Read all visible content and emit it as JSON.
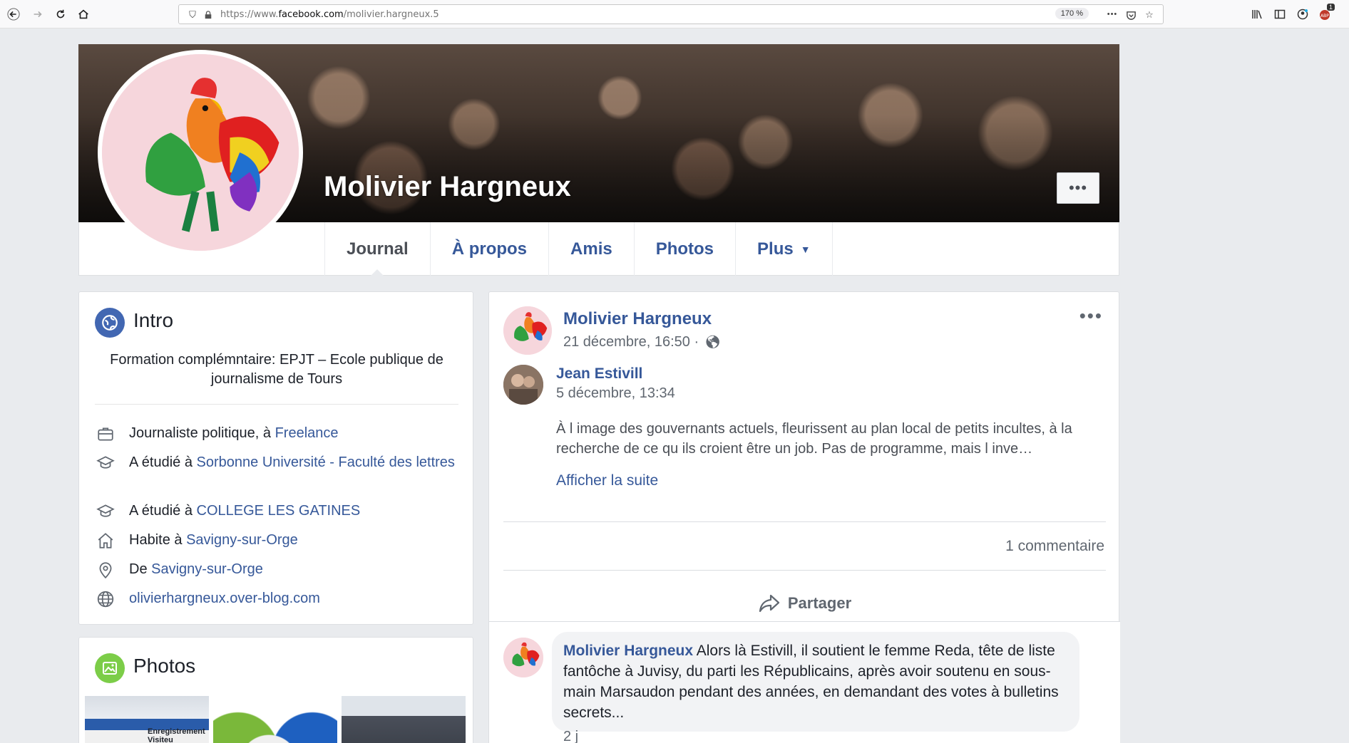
{
  "browser": {
    "url_prefix": "https://www.",
    "url_domain": "facebook.com",
    "url_path": "/molivier.hargneux.5",
    "zoom": "170 %",
    "more_label": "•••",
    "notif_badge": "1"
  },
  "profile": {
    "name": "Molivier Hargneux",
    "cover_more_label": "•••"
  },
  "tabs": [
    {
      "label": "Journal"
    },
    {
      "label": "À propos"
    },
    {
      "label": "Amis"
    },
    {
      "label": "Photos"
    },
    {
      "label": "Plus"
    }
  ],
  "intro": {
    "title": "Intro",
    "description": "Formation complémntaire: EPJT – Ecole publique de journalisme de Tours",
    "items": [
      {
        "icon": "briefcase-icon",
        "prefix": "Journaliste politique, à ",
        "link": "Freelance"
      },
      {
        "icon": "graduation-cap-icon",
        "prefix": "A étudié à ",
        "link": "Sorbonne Université - Faculté des lettres"
      },
      {
        "icon": "graduation-cap-icon",
        "prefix": "A étudié à ",
        "link": "COLLEGE LES GATINES"
      },
      {
        "icon": "home-icon",
        "prefix": "Habite à ",
        "link": "Savigny-sur-Orge"
      },
      {
        "icon": "location-pin-icon",
        "prefix": "De ",
        "link": "Savigny-sur-Orge"
      },
      {
        "icon": "globe-icon",
        "prefix": "",
        "link": "olivierhargneux.over-blog.com"
      }
    ]
  },
  "photos": {
    "title": "Photos",
    "thumb1_caption": "Enregistrement Visiteu"
  },
  "post": {
    "author": "Molivier Hargneux",
    "time": "21 décembre, 16:50 ·",
    "menu_label": "•••",
    "shared": {
      "author": "Jean Estivill",
      "time": "5 décembre, 13:34",
      "text": "À l image des gouvernants actuels, fleurissent au plan local de petits incultes, à la recherche de ce qu ils croient être un job. Pas de programme, mais l inve…",
      "see_more": "Afficher la suite"
    },
    "comment_count": "1 commentaire",
    "share_label": "Partager",
    "comment": {
      "author": "Molivier Hargneux",
      "text": " Alors là Estivill, il soutient le femme Reda, tête de liste fantôche à Juvisy, du parti les Républicains, après avoir soutenu en sous-main Marsaudon pendant des années, en demandant des votes à bulletins secrets...",
      "replies": "2 j"
    }
  },
  "colors": {
    "link": "#365899",
    "background": "#e9ebee",
    "intro_badge": "#4267b2",
    "photos_badge": "#7ccd48"
  }
}
